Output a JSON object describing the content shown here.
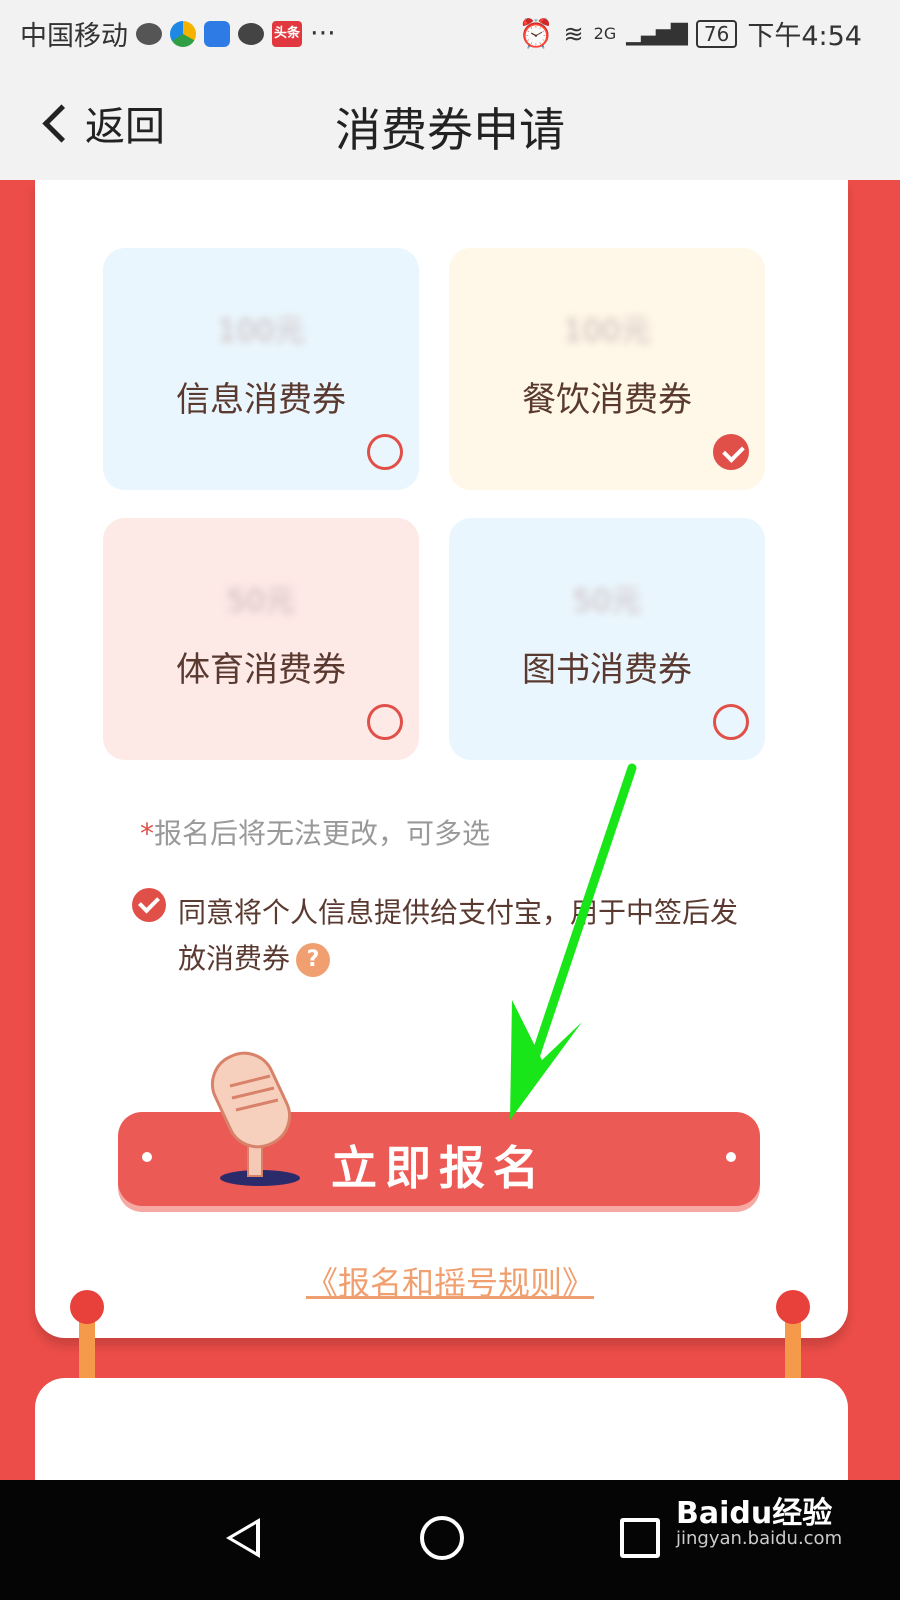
{
  "status_bar": {
    "carrier": "中国移动",
    "extra": "···",
    "toutiao_badge": "头条",
    "network": "2G",
    "battery": "76",
    "time": "下午4:54"
  },
  "header": {
    "back_label": "返回",
    "title": "消费券申请"
  },
  "vouchers": [
    {
      "amount": "100元",
      "name": "信息消费券",
      "selected": false,
      "bg": "#eaf6fd"
    },
    {
      "amount": "100元",
      "name": "餐饮消费券",
      "selected": true,
      "bg": "#fff7e8"
    },
    {
      "amount": "50元",
      "name": "体育消费券",
      "selected": false,
      "bg": "#fde9e6"
    },
    {
      "amount": "50元",
      "name": "图书消费券",
      "selected": false,
      "bg": "#eaf6fd"
    }
  ],
  "note": {
    "star": "*",
    "text": "报名后将无法更改，可多选"
  },
  "agreement": {
    "text": "同意将个人信息提供给支付宝，用于中签后发放消费券",
    "help_glyph": "?"
  },
  "signup_button": "立即报名",
  "rules_link": "《报名和摇号规则》",
  "colors": {
    "accent": "#e05048",
    "background_red": "#ec4d48",
    "link": "#f0a070"
  },
  "watermark": {
    "brand": "Baidu经验",
    "url": "jingyan.baidu.com"
  }
}
